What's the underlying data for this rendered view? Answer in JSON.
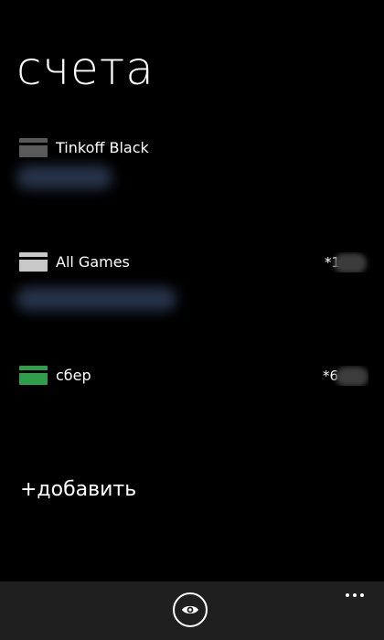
{
  "page": {
    "title": "счета"
  },
  "accounts": [
    {
      "name": "Tinkoff Black",
      "number": "",
      "card_color": "#5a5a5a",
      "icon": "card-icon"
    },
    {
      "name": "All Games",
      "number": "*1",
      "card_color": "#c8c8c8",
      "icon": "card-icon"
    },
    {
      "name": "сбер",
      "number": "*6",
      "card_color": "#2e9e4a",
      "icon": "card-icon"
    }
  ],
  "actions": {
    "add_label": "+добавить"
  },
  "app_bar": {
    "background": "#1f1f1f",
    "primary_icon": "eye-icon",
    "menu_icon": "ellipsis-icon"
  }
}
